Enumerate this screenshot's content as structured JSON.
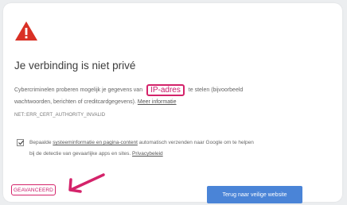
{
  "page": {
    "title": "Je verbinding is niet privé",
    "paragraph": {
      "line1_before": "Cybercriminelen proberen mogelijk je gegevens van",
      "highlight": "IP-adres",
      "line1_after": "te stelen (bijvoorbeeld",
      "line2_before": "wachtwoorden, berichten of creditcardgegevens).",
      "more_info_link": "Meer informatie"
    },
    "error_code": "NET::ERR_CERT_AUTHORITY_INVALID",
    "report": {
      "checked": true,
      "line1_before": "Bepaalde",
      "link1": "systeeminformatie en pagina-content",
      "line1_after": "automatisch verzenden naar Google om te helpen",
      "line2_before": "bij de detectie van gevaarlijke apps en sites.",
      "privacy_link": "Privacybeleid"
    },
    "buttons": {
      "advanced": "GEAVANCEERD",
      "back": "Terug naar veilige website"
    }
  },
  "colors": {
    "warning_red": "#d93025",
    "highlight_magenta": "#d4236a",
    "button_blue": "#4a84d7"
  },
  "icons": {
    "warning": "warning-triangle-icon",
    "arrow": "annotation-arrow-icon",
    "checkbox": "checkmark-icon"
  }
}
